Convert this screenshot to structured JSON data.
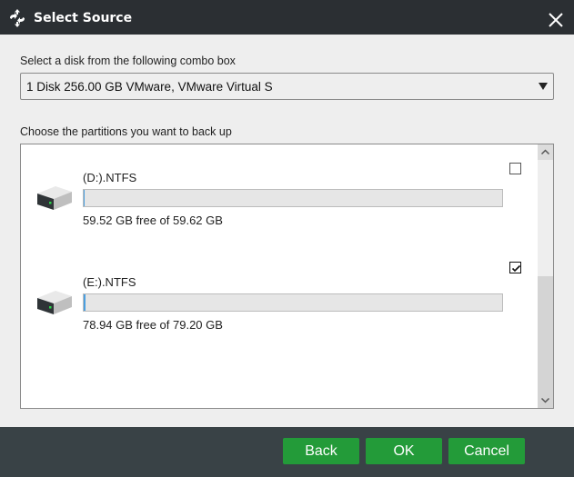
{
  "window": {
    "title": "Select Source",
    "app_icon": "sync-arrows-icon",
    "close_icon": "close-icon"
  },
  "disk_section": {
    "label": "Select a disk from the following combo box",
    "selected_disk": "1 Disk 256.00 GB VMware,  VMware Virtual S"
  },
  "partitions_section": {
    "label": "Choose the partitions you want to back up",
    "partitions": [
      {
        "name": "(D:).NTFS",
        "size_text": "59.52 GB free of 59.62 GB",
        "used_fraction": 0.0017,
        "checked": false,
        "icon": "hard-drive-icon"
      },
      {
        "name": "(E:).NTFS",
        "size_text": "78.94 GB free of 79.20 GB",
        "used_fraction": 0.0033,
        "checked": true,
        "icon": "hard-drive-icon"
      }
    ],
    "scroll_position_fraction": 1.0
  },
  "footer": {
    "back_label": "Back",
    "ok_label": "OK",
    "cancel_label": "Cancel",
    "button_color": "#239b39"
  }
}
